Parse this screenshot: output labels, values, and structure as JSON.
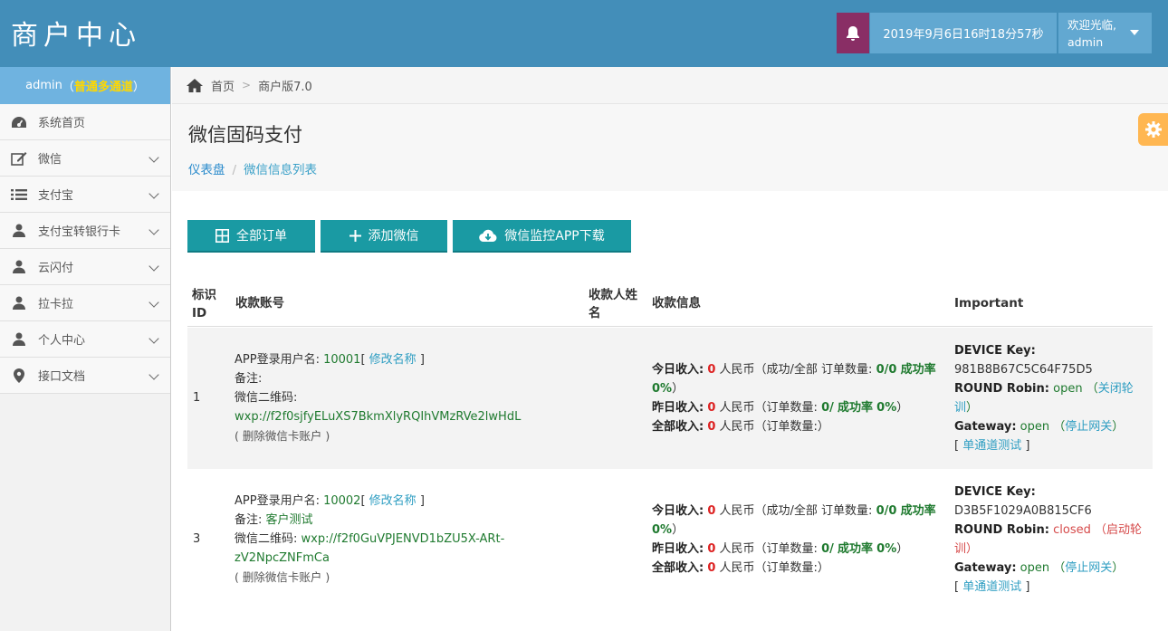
{
  "header": {
    "logo": "商户中心",
    "datetime": "2019年9月6日16时18分57秒",
    "welcome": "欢迎光临,",
    "username": "admin"
  },
  "sidebar": {
    "user": "admin",
    "user_tag": "普通多通道",
    "items": [
      {
        "label": "系统首页",
        "icon": "dashboard-icon",
        "expandable": false
      },
      {
        "label": "微信",
        "icon": "edit-icon",
        "expandable": true
      },
      {
        "label": "支付宝",
        "icon": "list-icon",
        "expandable": true
      },
      {
        "label": "支付宝转银行卡",
        "icon": "user-icon",
        "expandable": true
      },
      {
        "label": "云闪付",
        "icon": "user-icon",
        "expandable": true
      },
      {
        "label": "拉卡拉",
        "icon": "user-icon",
        "expandable": true
      },
      {
        "label": "个人中心",
        "icon": "user-icon",
        "expandable": true
      },
      {
        "label": "接口文档",
        "icon": "map-marker-icon",
        "expandable": true
      }
    ]
  },
  "breadcrumb": {
    "home": "首页",
    "current": "商户版7.0"
  },
  "page": {
    "title": "微信固码支付",
    "crumb_1": "仪表盘",
    "crumb_2": "微信信息列表"
  },
  "buttons": {
    "all_orders": "全部订单",
    "add_wechat": "添加微信",
    "download_app": "微信监控APP下载"
  },
  "table": {
    "headers": {
      "id": "标识ID",
      "account": "收款账号",
      "payee": "收款人姓名",
      "info": "收款信息",
      "important": "Important"
    },
    "rows": [
      {
        "id": "1",
        "login_label": "APP登录用户名:",
        "login": "10001",
        "rename": "修改名称",
        "remark_label": "备注:",
        "remark": "",
        "qr_label": "微信二维码:",
        "qr": "wxp://f2f0sjfyELuXS7BkmXlyRQIhVMzRVe2lwHdL",
        "delete": "删除微信卡账户",
        "today_label": "今日收入:",
        "today": "0",
        "today_unit": "人民币（成功/全部 订单数量:",
        "today_orders": "0/0",
        "today_rate_label": "成功率",
        "today_rate": "0%",
        "yesterday_label": "昨日收入:",
        "yesterday": "0",
        "yesterday_unit": "人民币（订单数量:",
        "yesterday_orders": "0/",
        "yesterday_rate_label": "成功率",
        "yesterday_rate": "0%",
        "total_label": "全部收入:",
        "total": "0",
        "total_unit": "人民币（订单数量:）",
        "device_key_label": "DEVICE Key:",
        "device_key": "981B8B67C5C64F75D5",
        "round_robin_label": "ROUND Robin:",
        "round_robin": "open",
        "round_robin_action": "关闭轮训",
        "gateway_label": "Gateway:",
        "gateway": "open",
        "gateway_action": "停止网关",
        "test": "单通道测试"
      },
      {
        "id": "3",
        "login_label": "APP登录用户名:",
        "login": "10002",
        "rename": "修改名称",
        "remark_label": "备注:",
        "remark": "客户测试",
        "qr_label": "微信二维码:",
        "qr": "wxp://f2f0GuVPJENVD1bZU5X-ARt-zV2NpcZNFmCa",
        "delete": "删除微信卡账户",
        "today_label": "今日收入:",
        "today": "0",
        "today_unit": "人民币（成功/全部 订单数量:",
        "today_orders": "0/0",
        "today_rate_label": "成功率",
        "today_rate": "0%",
        "yesterday_label": "昨日收入:",
        "yesterday": "0",
        "yesterday_unit": "人民币（订单数量:",
        "yesterday_orders": "0/",
        "yesterday_rate_label": "成功率",
        "yesterday_rate": "0%",
        "total_label": "全部收入:",
        "total": "0",
        "total_unit": "人民币（订单数量:）",
        "device_key_label": "DEVICE Key:",
        "device_key": "D3B5F1029A0B815CF6",
        "round_robin_label": "ROUND Robin:",
        "round_robin": "closed",
        "round_robin_action": "启动轮训",
        "gateway_label": "Gateway:",
        "gateway": "open",
        "gateway_action": "停止网关",
        "test": "单通道测试"
      }
    ]
  }
}
